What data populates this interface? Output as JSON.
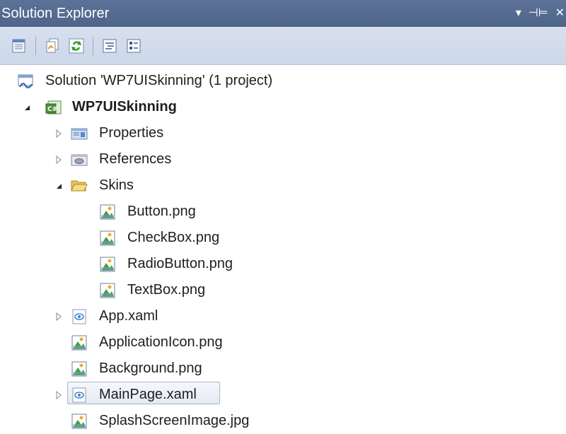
{
  "panel": {
    "title": "Solution Explorer",
    "controls": {
      "dropdown": "▾",
      "pin": "⊣⊨",
      "close": "✕"
    }
  },
  "toolbar": {
    "buttons": [
      {
        "icon": "properties-icon"
      },
      {
        "icon": "show-all-files-icon"
      },
      {
        "icon": "refresh-icon"
      },
      {
        "icon": "view-code-icon"
      },
      {
        "icon": "view-designer-icon"
      }
    ]
  },
  "tree": {
    "solution": {
      "label": "Solution 'WP7UISkinning' (1 project)",
      "icon": "solution-icon"
    },
    "project": {
      "label": "WP7UISkinning",
      "icon": "csharp-project-icon",
      "expanded": true
    },
    "items": [
      {
        "label": "Properties",
        "icon": "properties-folder-icon",
        "expander": "collapsed"
      },
      {
        "label": "References",
        "icon": "references-icon",
        "expander": "collapsed"
      },
      {
        "label": "Skins",
        "icon": "folder-open-icon",
        "expander": "expanded"
      },
      {
        "label": "Button.png",
        "icon": "image-file-icon",
        "expander": "none"
      },
      {
        "label": "CheckBox.png",
        "icon": "image-file-icon",
        "expander": "none"
      },
      {
        "label": "RadioButton.png",
        "icon": "image-file-icon",
        "expander": "none"
      },
      {
        "label": "TextBox.png",
        "icon": "image-file-icon",
        "expander": "none"
      },
      {
        "label": "App.xaml",
        "icon": "xaml-file-icon",
        "expander": "collapsed"
      },
      {
        "label": "ApplicationIcon.png",
        "icon": "image-file-icon",
        "expander": "none"
      },
      {
        "label": "Background.png",
        "icon": "image-file-icon",
        "expander": "none"
      },
      {
        "label": "MainPage.xaml",
        "icon": "xaml-file-icon",
        "expander": "collapsed",
        "selected": true
      },
      {
        "label": "SplashScreenImage.jpg",
        "icon": "image-file-icon",
        "expander": "none"
      }
    ]
  },
  "colors": {
    "titlebar": "#53688d",
    "toolbar": "#d1dbea",
    "selection_border": "#a7b7cc",
    "text": "#1e1e1e"
  }
}
